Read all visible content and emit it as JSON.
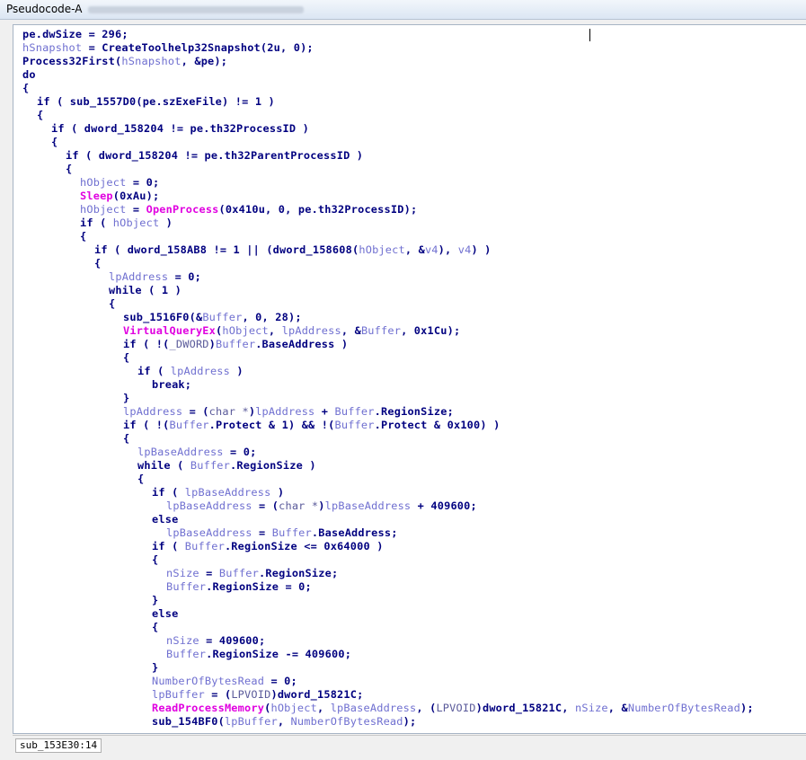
{
  "window": {
    "title": "Pseudocode-A"
  },
  "status": {
    "location": "sub_153E30:14"
  },
  "colors": {
    "keyword": "#000080",
    "variable": "#6f6fd0",
    "function": "#e000e0",
    "type": "#5a5a9a"
  },
  "code_lines": [
    {
      "indent": 0,
      "tokens": [
        [
          "kw",
          "pe.dwSize = 296;"
        ]
      ]
    },
    {
      "indent": 0,
      "tokens": [
        [
          "var",
          "hSnapshot"
        ],
        [
          "kw",
          " = CreateToolhelp32Snapshot(2u, 0);"
        ]
      ]
    },
    {
      "indent": 0,
      "tokens": [
        [
          "kw",
          "Process32First("
        ],
        [
          "var",
          "hSnapshot"
        ],
        [
          "kw",
          ", &pe);"
        ]
      ]
    },
    {
      "indent": 0,
      "tokens": [
        [
          "kw",
          "do"
        ]
      ]
    },
    {
      "indent": 0,
      "tokens": [
        [
          "kw",
          "{"
        ]
      ]
    },
    {
      "indent": 1,
      "tokens": [
        [
          "kw",
          "if ( sub_1557D0(pe.szExeFile) != 1 )"
        ]
      ]
    },
    {
      "indent": 1,
      "tokens": [
        [
          "kw",
          "{"
        ]
      ]
    },
    {
      "indent": 2,
      "tokens": [
        [
          "kw",
          "if ( dword_158204 != pe.th32ProcessID )"
        ]
      ]
    },
    {
      "indent": 2,
      "tokens": [
        [
          "kw",
          "{"
        ]
      ]
    },
    {
      "indent": 3,
      "tokens": [
        [
          "kw",
          "if ( dword_158204 != pe.th32ParentProcessID )"
        ]
      ]
    },
    {
      "indent": 3,
      "tokens": [
        [
          "kw",
          "{"
        ]
      ]
    },
    {
      "indent": 4,
      "tokens": [
        [
          "var",
          "hObject"
        ],
        [
          "kw",
          " = 0;"
        ]
      ]
    },
    {
      "indent": 4,
      "tokens": [
        [
          "fn",
          "Sleep"
        ],
        [
          "kw",
          "(0xAu);"
        ]
      ]
    },
    {
      "indent": 4,
      "tokens": [
        [
          "var",
          "hObject"
        ],
        [
          "kw",
          " = "
        ],
        [
          "fn",
          "OpenProcess"
        ],
        [
          "kw",
          "(0x410u, 0, pe.th32ProcessID);"
        ]
      ]
    },
    {
      "indent": 4,
      "tokens": [
        [
          "kw",
          "if ( "
        ],
        [
          "var",
          "hObject"
        ],
        [
          "kw",
          " )"
        ]
      ]
    },
    {
      "indent": 4,
      "tokens": [
        [
          "kw",
          "{"
        ]
      ]
    },
    {
      "indent": 5,
      "tokens": [
        [
          "kw",
          "if ( dword_158AB8 != 1 || (dword_158608("
        ],
        [
          "var",
          "hObject"
        ],
        [
          "kw",
          ", &"
        ],
        [
          "var",
          "v4"
        ],
        [
          "kw",
          "), "
        ],
        [
          "var",
          "v4"
        ],
        [
          "kw",
          ") )"
        ]
      ]
    },
    {
      "indent": 5,
      "tokens": [
        [
          "kw",
          "{"
        ]
      ]
    },
    {
      "indent": 6,
      "tokens": [
        [
          "var",
          "lpAddress"
        ],
        [
          "kw",
          " = 0;"
        ]
      ]
    },
    {
      "indent": 6,
      "tokens": [
        [
          "kw",
          "while ( 1 )"
        ]
      ]
    },
    {
      "indent": 6,
      "tokens": [
        [
          "kw",
          "{"
        ]
      ]
    },
    {
      "indent": 7,
      "tokens": [
        [
          "kw",
          "sub_1516F0(&"
        ],
        [
          "var",
          "Buffer"
        ],
        [
          "kw",
          ", 0, 28);"
        ]
      ]
    },
    {
      "indent": 7,
      "tokens": [
        [
          "fn",
          "VirtualQueryEx"
        ],
        [
          "kw",
          "("
        ],
        [
          "var",
          "hObject"
        ],
        [
          "kw",
          ", "
        ],
        [
          "var",
          "lpAddress"
        ],
        [
          "kw",
          ", &"
        ],
        [
          "var",
          "Buffer"
        ],
        [
          "kw",
          ", 0x1Cu);"
        ]
      ]
    },
    {
      "indent": 7,
      "tokens": [
        [
          "kw",
          "if ( !("
        ],
        [
          "t",
          "_DWORD"
        ],
        [
          "kw",
          ")"
        ],
        [
          "var",
          "Buffer"
        ],
        [
          "kw",
          ".BaseAddress )"
        ]
      ]
    },
    {
      "indent": 7,
      "tokens": [
        [
          "kw",
          "{"
        ]
      ]
    },
    {
      "indent": 8,
      "tokens": [
        [
          "kw",
          "if ( "
        ],
        [
          "var",
          "lpAddress"
        ],
        [
          "kw",
          " )"
        ]
      ]
    },
    {
      "indent": 9,
      "tokens": [
        [
          "kw",
          "break;"
        ]
      ]
    },
    {
      "indent": 7,
      "tokens": [
        [
          "kw",
          "}"
        ]
      ]
    },
    {
      "indent": 7,
      "tokens": [
        [
          "var",
          "lpAddress"
        ],
        [
          "kw",
          " = ("
        ],
        [
          "t",
          "char *"
        ],
        [
          "kw",
          ")"
        ],
        [
          "var",
          "lpAddress"
        ],
        [
          "kw",
          " + "
        ],
        [
          "var",
          "Buffer"
        ],
        [
          "kw",
          ".RegionSize;"
        ]
      ]
    },
    {
      "indent": 7,
      "tokens": [
        [
          "kw",
          "if ( !("
        ],
        [
          "var",
          "Buffer"
        ],
        [
          "kw",
          ".Protect & 1) && !("
        ],
        [
          "var",
          "Buffer"
        ],
        [
          "kw",
          ".Protect & 0x100) )"
        ]
      ]
    },
    {
      "indent": 7,
      "tokens": [
        [
          "kw",
          "{"
        ]
      ]
    },
    {
      "indent": 8,
      "tokens": [
        [
          "var",
          "lpBaseAddress"
        ],
        [
          "kw",
          " = 0;"
        ]
      ]
    },
    {
      "indent": 8,
      "tokens": [
        [
          "kw",
          "while ( "
        ],
        [
          "var",
          "Buffer"
        ],
        [
          "kw",
          ".RegionSize )"
        ]
      ]
    },
    {
      "indent": 8,
      "tokens": [
        [
          "kw",
          "{"
        ]
      ]
    },
    {
      "indent": 9,
      "tokens": [
        [
          "kw",
          "if ( "
        ],
        [
          "var",
          "lpBaseAddress"
        ],
        [
          "kw",
          " )"
        ]
      ]
    },
    {
      "indent": 10,
      "tokens": [
        [
          "var",
          "lpBaseAddress"
        ],
        [
          "kw",
          " = ("
        ],
        [
          "t",
          "char *"
        ],
        [
          "kw",
          ")"
        ],
        [
          "var",
          "lpBaseAddress"
        ],
        [
          "kw",
          " + 409600;"
        ]
      ]
    },
    {
      "indent": 9,
      "tokens": [
        [
          "kw",
          "else"
        ]
      ]
    },
    {
      "indent": 10,
      "tokens": [
        [
          "var",
          "lpBaseAddress"
        ],
        [
          "kw",
          " = "
        ],
        [
          "var",
          "Buffer"
        ],
        [
          "kw",
          ".BaseAddress;"
        ]
      ]
    },
    {
      "indent": 9,
      "tokens": [
        [
          "kw",
          "if ( "
        ],
        [
          "var",
          "Buffer"
        ],
        [
          "kw",
          ".RegionSize <= 0x64000 )"
        ]
      ]
    },
    {
      "indent": 9,
      "tokens": [
        [
          "kw",
          "{"
        ]
      ]
    },
    {
      "indent": 10,
      "tokens": [
        [
          "var",
          "nSize"
        ],
        [
          "kw",
          " = "
        ],
        [
          "var",
          "Buffer"
        ],
        [
          "kw",
          ".RegionSize;"
        ]
      ]
    },
    {
      "indent": 10,
      "tokens": [
        [
          "var",
          "Buffer"
        ],
        [
          "kw",
          ".RegionSize = 0;"
        ]
      ]
    },
    {
      "indent": 9,
      "tokens": [
        [
          "kw",
          "}"
        ]
      ]
    },
    {
      "indent": 9,
      "tokens": [
        [
          "kw",
          "else"
        ]
      ]
    },
    {
      "indent": 9,
      "tokens": [
        [
          "kw",
          "{"
        ]
      ]
    },
    {
      "indent": 10,
      "tokens": [
        [
          "var",
          "nSize"
        ],
        [
          "kw",
          " = 409600;"
        ]
      ]
    },
    {
      "indent": 10,
      "tokens": [
        [
          "var",
          "Buffer"
        ],
        [
          "kw",
          ".RegionSize -= 409600;"
        ]
      ]
    },
    {
      "indent": 9,
      "tokens": [
        [
          "kw",
          "}"
        ]
      ]
    },
    {
      "indent": 9,
      "tokens": [
        [
          "var",
          "NumberOfBytesRead"
        ],
        [
          "kw",
          " = 0;"
        ]
      ]
    },
    {
      "indent": 9,
      "tokens": [
        [
          "var",
          "lpBuffer"
        ],
        [
          "kw",
          " = ("
        ],
        [
          "t",
          "LPVOID"
        ],
        [
          "kw",
          ")dword_15821C;"
        ]
      ]
    },
    {
      "indent": 9,
      "tokens": [
        [
          "fn",
          "ReadProcessMemory"
        ],
        [
          "kw",
          "("
        ],
        [
          "var",
          "hObject"
        ],
        [
          "kw",
          ", "
        ],
        [
          "var",
          "lpBaseAddress"
        ],
        [
          "kw",
          ", ("
        ],
        [
          "t",
          "LPVOID"
        ],
        [
          "kw",
          ")dword_15821C, "
        ],
        [
          "var",
          "nSize"
        ],
        [
          "kw",
          ", &"
        ],
        [
          "var",
          "NumberOfBytesRead"
        ],
        [
          "kw",
          ");"
        ]
      ]
    },
    {
      "indent": 9,
      "tokens": [
        [
          "kw",
          "sub_154BF0("
        ],
        [
          "var",
          "lpBuffer"
        ],
        [
          "kw",
          ", "
        ],
        [
          "var",
          "NumberOfBytesRead"
        ],
        [
          "kw",
          ");"
        ]
      ]
    }
  ]
}
